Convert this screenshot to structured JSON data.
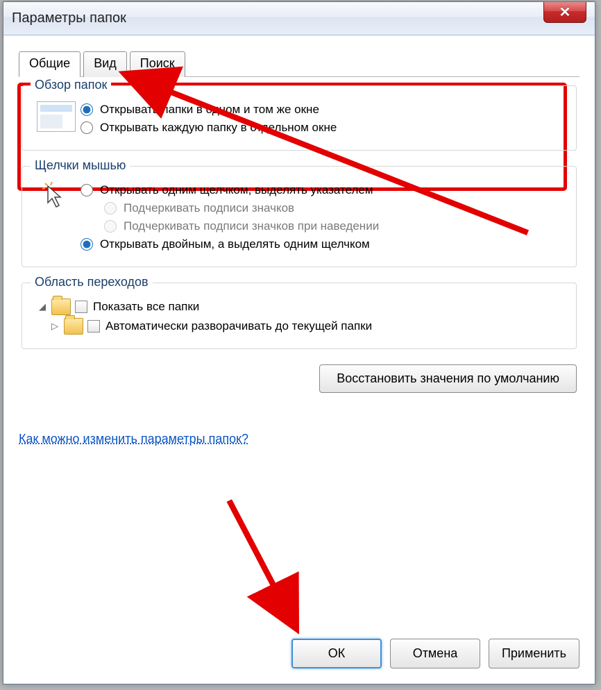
{
  "window": {
    "title": "Параметры папок"
  },
  "tabs": [
    {
      "label": "Общие",
      "active": true
    },
    {
      "label": "Вид",
      "active": false
    },
    {
      "label": "Поиск",
      "active": false
    }
  ],
  "groups": {
    "browse": {
      "legend": "Обзор папок",
      "opt_same_window": "Открывать папки в одном и том же окне",
      "opt_new_window": "Открывать каждую папку в отдельном окне"
    },
    "click": {
      "legend": "Щелчки мышью",
      "opt_single": "Открывать одним щелчком, выделять указателем",
      "opt_underline_always": "Подчеркивать подписи значков",
      "opt_underline_hover": "Подчеркивать подписи значков при наведении",
      "opt_double": "Открывать двойным, а выделять одним щелчком"
    },
    "nav": {
      "legend": "Область переходов",
      "opt_show_all": "Показать все папки",
      "opt_auto_expand": "Автоматически разворачивать до текущей папки"
    }
  },
  "restore_defaults": "Восстановить значения по умолчанию",
  "help_link": "Как можно изменить параметры папок?",
  "buttons": {
    "ok": "ОК",
    "cancel": "Отмена",
    "apply": "Применить"
  }
}
